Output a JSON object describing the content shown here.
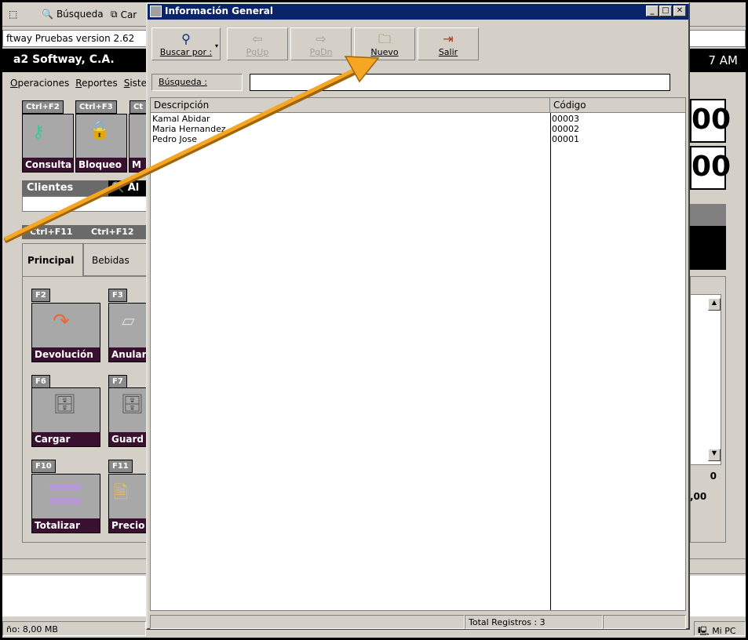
{
  "bg": {
    "toolbar": {
      "search": "Búsqueda",
      "car": "Car"
    },
    "address": "ftway Pruebas version 2.62",
    "title": "a2 Softway, C.A.",
    "time": "7 AM",
    "menu": [
      "Operaciones",
      "Reportes",
      "Siste"
    ],
    "keys_top": [
      "Ctrl+F2",
      "Ctrl+F3",
      "Ct"
    ],
    "tiles_top": [
      "Consulta",
      "Bloqueo",
      "M"
    ],
    "clients_label": "Clientes",
    "clients_tag": "Al",
    "keys_mid": [
      "Ctrl+F11",
      "Ctrl+F12"
    ],
    "tabs": [
      "Principal",
      "Bebidas"
    ],
    "fkeys": [
      "F2",
      "F3",
      "F6",
      "F7",
      "F10",
      "F11"
    ],
    "tiles": [
      "Devolución",
      "Anular",
      "Cargar",
      "Guard",
      "Totalizar",
      "Precio"
    ],
    "right_values": [
      "00",
      "00",
      "0",
      ",00"
    ],
    "memory": "ño: 8,00 MB",
    "mi_pc": "Mi PC"
  },
  "dialog": {
    "title": "Información General",
    "buttons": [
      {
        "label": "Buscar por :",
        "icon": "magnifier-icon",
        "enabled": true
      },
      {
        "label": "PgUp",
        "icon": "arrow-left-icon",
        "enabled": false
      },
      {
        "label": "PgDn",
        "icon": "arrow-right-icon",
        "enabled": false
      },
      {
        "label": "Nuevo",
        "icon": "new-folder-icon",
        "enabled": true
      },
      {
        "label": "Salir",
        "icon": "exit-door-icon",
        "enabled": true
      }
    ],
    "search_label": "Búsqueda :",
    "search_value": "",
    "columns": [
      "Descripción",
      "Código"
    ],
    "rows": [
      {
        "descripcion": "Kamal Abidar",
        "codigo": "00003"
      },
      {
        "descripcion": "Maria Hernandez",
        "codigo": "00002"
      },
      {
        "descripcion": "Pedro Jose",
        "codigo": "00001"
      }
    ],
    "status": "Total Registros : 3"
  },
  "colors": {
    "titlebar": "#0a246a",
    "arrow": "#f5a623",
    "tile_label": "#3a1030"
  }
}
